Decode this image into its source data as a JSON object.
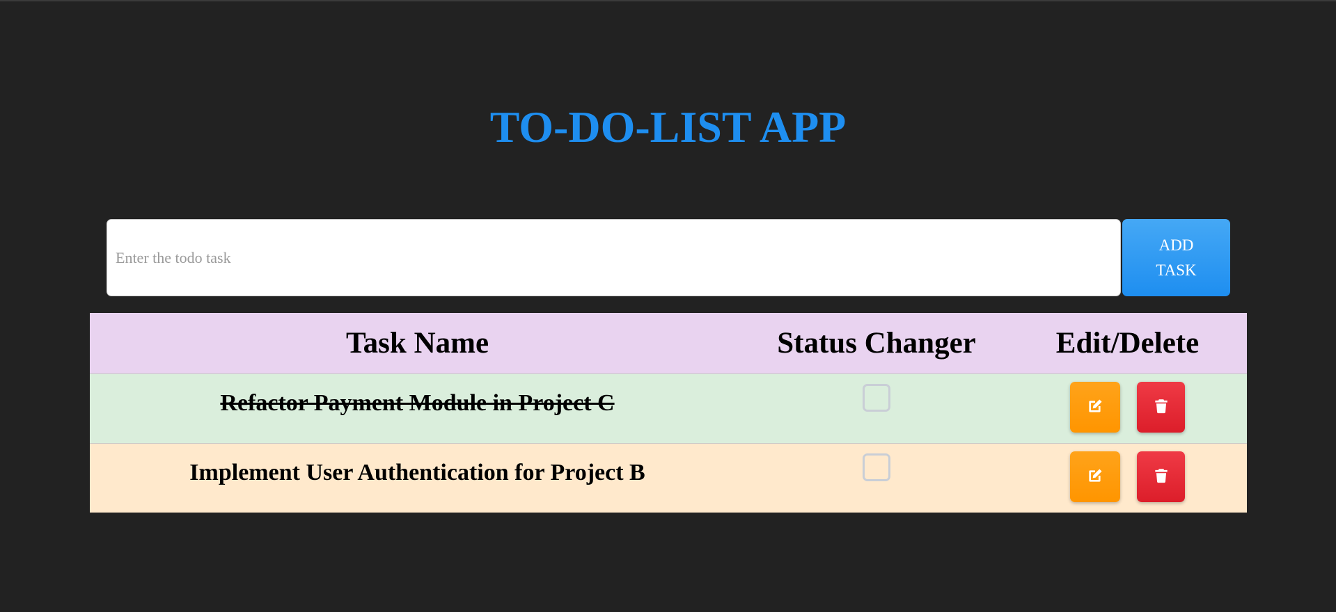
{
  "app": {
    "title": "TO-DO-LIST APP",
    "title_color": "#1e8ef0",
    "background": "#222222"
  },
  "add_form": {
    "input_value": "",
    "input_placeholder": "Enter the todo task",
    "add_button_label": "ADD TASK"
  },
  "table": {
    "headers": [
      "Task Name",
      "Status Changer",
      "Edit/Delete"
    ],
    "rows": [
      {
        "task": "Refactor Payment Module in Project C",
        "completed": true,
        "row_color": "#daeedc",
        "edit_icon": "pencil-square-icon",
        "delete_icon": "trash-icon"
      },
      {
        "task": "Implement User Authentication for Project B",
        "completed": false,
        "row_color": "#ffe9cc",
        "edit_icon": "pencil-square-icon",
        "delete_icon": "trash-icon"
      }
    ]
  },
  "colors": {
    "header_bg": "#e9d3f0",
    "edit_button": "#ff9800",
    "delete_button": "#e3232f",
    "add_button": "#2196f3"
  }
}
